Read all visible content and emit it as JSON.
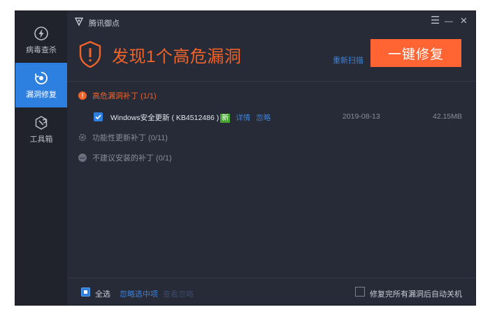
{
  "sidebar": {
    "items": [
      {
        "label": "病毒查杀",
        "icon": "bolt-icon",
        "active": false
      },
      {
        "label": "漏洞修复",
        "icon": "shield-refresh-icon",
        "active": true
      },
      {
        "label": "工具箱",
        "icon": "wrench-icon",
        "active": false
      }
    ]
  },
  "titlebar": {
    "title": "腾讯御点",
    "menu_glyph": "☰",
    "minimize_glyph": "—",
    "close_glyph": "✕"
  },
  "header": {
    "headline": "发现1个高危漏洞",
    "rescan_label": "重新扫描",
    "fix_button_label": "一键修复"
  },
  "groups": [
    {
      "label": "高危漏洞补丁 (1/1)",
      "status_glyph": "!",
      "color": "#f0642a"
    },
    {
      "label": "功能性更新补丁 (0/11)",
      "status_glyph": "",
      "color": "#6b6e7c"
    },
    {
      "label": "不建议安装的补丁 (0/1)",
      "status_glyph": "—",
      "color": "#6b6e7c"
    }
  ],
  "patch": {
    "name": "Windows安全更新 ( KB4512486 )",
    "new_badge": "新",
    "details_link": "详情",
    "ignore_link": "忽略",
    "date": "2019-08-13",
    "size": "42.15MB",
    "checked": true
  },
  "footer": {
    "select_all_label": "全选",
    "ignore_selected_label": "忽略选中项",
    "ignored_label": "查看忽略",
    "auto_shutdown_label": "修复完所有漏洞后自动关机"
  },
  "colors": {
    "accent_orange": "#ff6432",
    "accent_blue": "#2d7fe0",
    "background": "#272a37",
    "sidebar": "#20222c"
  }
}
